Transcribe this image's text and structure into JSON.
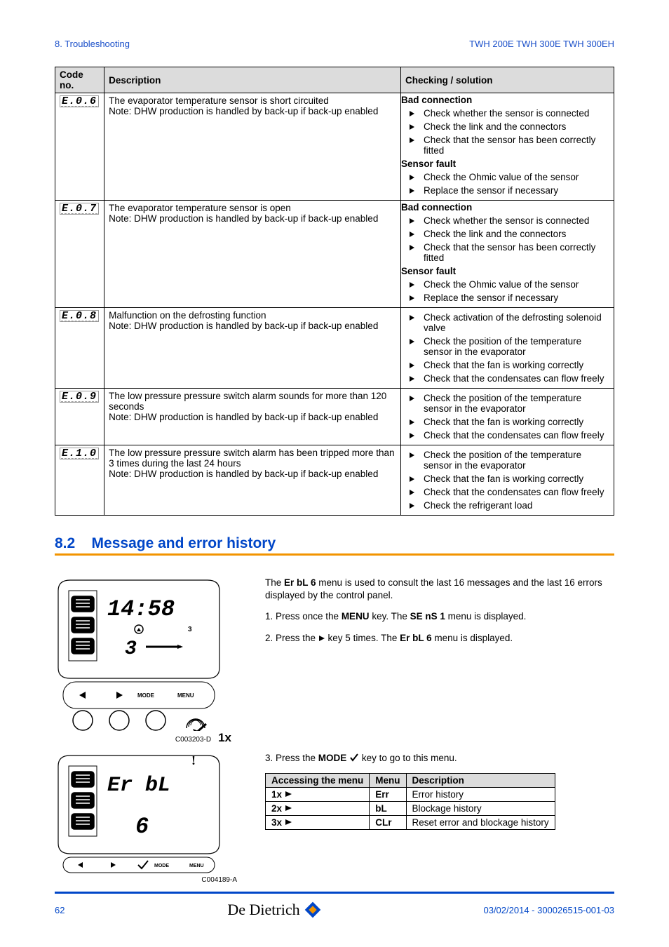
{
  "header": {
    "left": "8.  Troubleshooting",
    "right": "TWH 200E TWH 300E TWH 300EH"
  },
  "trouble_table": {
    "headers": [
      "Code no.",
      "Description",
      "Checking / solution"
    ],
    "rows": [
      {
        "code": "E.0.6",
        "description": "The evaporator temperature sensor is short circuited\nNote: DHW production is handled by back-up if back-up enabled",
        "solution": {
          "groups": [
            {
              "title": "Bad connection",
              "items": [
                "Check whether the sensor is connected",
                "Check the link and the connectors",
                "Check that the sensor has been correctly fitted"
              ]
            },
            {
              "title": "Sensor fault",
              "items": [
                "Check the Ohmic value of the sensor",
                "Replace the sensor if necessary"
              ]
            }
          ]
        }
      },
      {
        "code": "E.0.7",
        "description": "The evaporator temperature sensor is open\nNote: DHW production is handled by back-up if back-up enabled",
        "solution": {
          "groups": [
            {
              "title": "Bad connection",
              "items": [
                "Check whether the sensor is connected",
                "Check the link and the connectors",
                "Check that the sensor has been correctly fitted"
              ]
            },
            {
              "title": "Sensor fault",
              "items": [
                "Check the Ohmic value of the sensor",
                "Replace the sensor if necessary"
              ]
            }
          ]
        }
      },
      {
        "code": "E.0.8",
        "description": "Malfunction on the defrosting function\nNote: DHW production is handled by back-up if back-up enabled",
        "solution": {
          "items": [
            "Check activation of the defrosting solenoid valve",
            "Check the position of the temperature sensor in the evaporator",
            "Check that the fan is working correctly",
            "Check that the condensates can flow freely"
          ]
        }
      },
      {
        "code": "E.0.9",
        "description": "The low pressure pressure switch alarm sounds for more than 120 seconds\nNote: DHW production is handled by back-up if back-up enabled",
        "solution": {
          "items": [
            "Check the position of the temperature sensor in the evaporator",
            "Check that the fan is working correctly",
            "Check that the condensates can flow freely"
          ]
        }
      },
      {
        "code": "E.1.0",
        "description": "The low pressure pressure switch alarm has been tripped more than 3 times during the last 24 hours\nNote: DHW production is handled by back-up if back-up enabled",
        "solution": {
          "items": [
            "Check the position of the temperature sensor in the evaporator",
            "Check that the fan is working correctly",
            "Check that the condensates can flow freely",
            "Check the refrigerant load"
          ]
        }
      }
    ]
  },
  "section": {
    "number": "8.2",
    "title": "Message and error history"
  },
  "intro": {
    "line1_a": "The ",
    "line1_b": "Er bL 6",
    "line1_c": " menu is used to consult the last 16 messages and the last 16 errors displayed by the control panel.",
    "step1_a": "1.  Press once the ",
    "step1_b": "MENU",
    "step1_c": " key. The ",
    "step1_d": "SE nS 1",
    "step1_e": " menu is displayed.",
    "step2_a": "2.  Press the ",
    "step2_b": " key 5 times. The ",
    "step2_c": "Er bL 6",
    "step2_d": " menu is displayed.",
    "step3_a": "3.  Press the ",
    "step3_b": "MODE",
    "step3_c": " key to go to this menu."
  },
  "menu_table": {
    "headers": [
      "Accessing the menu",
      "Menu",
      "Description"
    ],
    "rows": [
      {
        "press": "1x",
        "menu": "Err",
        "desc": "Error history"
      },
      {
        "press": "2x",
        "menu": "bL",
        "desc": "Blockage history"
      },
      {
        "press": "3x",
        "menu": "CLr",
        "desc": "Reset error and blockage history"
      }
    ]
  },
  "figures": {
    "fig1": {
      "display": "14:58",
      "ref": "C003203-D",
      "press": "1x"
    },
    "fig2": {
      "display_top": "Er bL",
      "display_sub": "6",
      "ref": "C004189-A"
    }
  },
  "footer": {
    "page": "62",
    "logo": "De Dietrich",
    "docref": "03/02/2014 - 300026515-001-03"
  }
}
